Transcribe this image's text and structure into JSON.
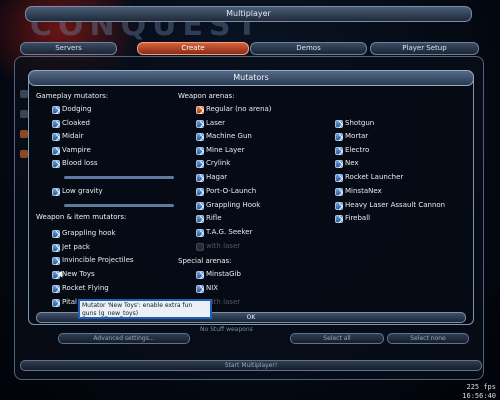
{
  "window": {
    "title": "Multiplayer"
  },
  "logo": {
    "text": "CONQUEST"
  },
  "top_tabs": [
    {
      "label": "Servers",
      "active": false
    },
    {
      "label": "Create",
      "active": true
    },
    {
      "label": "Demos",
      "active": false
    },
    {
      "label": "Player Setup",
      "active": false
    }
  ],
  "dialog": {
    "title": "Mutators",
    "gameplay_header": "Gameplay mutators:",
    "weapon_arenas_header": "Weapon arenas:",
    "weapon_item_header": "Weapon & item mutators:",
    "special_arenas_header": "Special arenas:",
    "gameplay": [
      {
        "label": "Dodging",
        "checked": true
      },
      {
        "label": "Cloaked",
        "checked": true
      },
      {
        "label": "Midair",
        "checked": true
      },
      {
        "label": "Vampire",
        "checked": true
      },
      {
        "label": "Blood loss",
        "checked": true
      },
      {
        "label": "Low gravity",
        "checked": true
      }
    ],
    "weapon_item": [
      {
        "label": "Grappling hook",
        "checked": true
      },
      {
        "label": "Jet pack",
        "checked": true
      },
      {
        "label": "Invincible Projectiles",
        "checked": true
      },
      {
        "label": "New Toys",
        "checked": true
      },
      {
        "label": "Rocket Flying",
        "checked": true
      },
      {
        "label": "Pital",
        "checked": true
      }
    ],
    "arenas_col1": [
      {
        "label": "Regular (no arena)",
        "checked": true,
        "highlight": true
      },
      {
        "label": "Laser",
        "checked": true
      },
      {
        "label": "Machine Gun",
        "checked": true
      },
      {
        "label": "Mine Layer",
        "checked": true
      },
      {
        "label": "Crylink",
        "checked": true
      },
      {
        "label": "Hagar",
        "checked": true
      },
      {
        "label": "Port-O-Launch",
        "checked": true
      },
      {
        "label": "Grappling Hook",
        "checked": true
      },
      {
        "label": "Rifle",
        "checked": true
      },
      {
        "label": "T.A.G. Seeker",
        "checked": true
      },
      {
        "label": "with laser",
        "checked": false,
        "disabled": true
      }
    ],
    "arenas_col2": [
      {
        "label": "Shotgun",
        "checked": true
      },
      {
        "label": "Mortar",
        "checked": true
      },
      {
        "label": "Electro",
        "checked": true
      },
      {
        "label": "Nex",
        "checked": true
      },
      {
        "label": "Rocket Launcher",
        "checked": true
      },
      {
        "label": "MinstaNex",
        "checked": true
      },
      {
        "label": "Heavy Laser Assault Cannon",
        "checked": true
      },
      {
        "label": "Fireball",
        "checked": true
      }
    ],
    "special_arenas": [
      {
        "label": "MinstaGib",
        "checked": true
      },
      {
        "label": "NIX",
        "checked": true
      },
      {
        "label": "with laser",
        "checked": false,
        "disabled": true
      }
    ],
    "ok_label": "OK",
    "tooltip": "Mutator 'New Toys': enable extra fun guns (g_new_toys)"
  },
  "background": {
    "hidden_label": "No Stuff weapons",
    "advanced_label": "Advanced settings...",
    "select_all": "Select all",
    "select_none": "Select none",
    "start_label": "Start Multiplayer!"
  },
  "status": {
    "fps": "225 fps",
    "clock": "16:56:40"
  },
  "colors": {
    "accent": "#d6633c",
    "checkbox": "#4a80c0",
    "tooltip_border": "#1f60b8"
  }
}
